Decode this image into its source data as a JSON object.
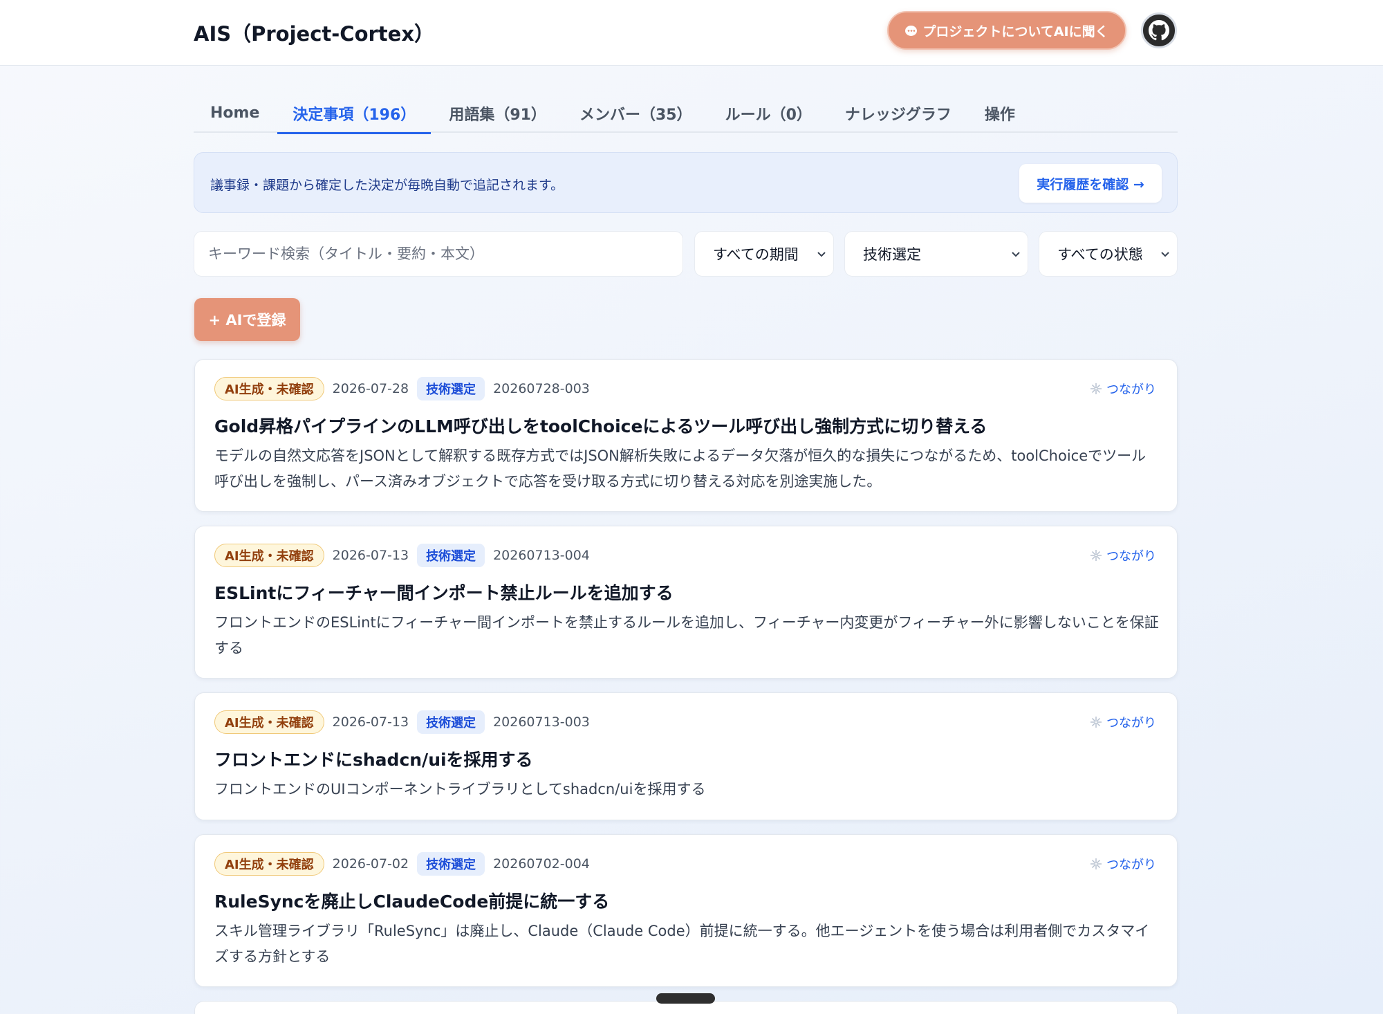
{
  "header": {
    "title": "AIS（Project-Cortex）",
    "ask_ai_label": "プロジェクトについてAIに聞く",
    "github_icon": "github-icon"
  },
  "tabs": [
    {
      "label": "Home",
      "active": false
    },
    {
      "label": "決定事項（196）",
      "active": true
    },
    {
      "label": "用語集（91）",
      "active": false
    },
    {
      "label": "メンバー（35）",
      "active": false
    },
    {
      "label": "ルール（0）",
      "active": false
    },
    {
      "label": "ナレッジグラフ",
      "active": false
    },
    {
      "label": "操作",
      "active": false
    }
  ],
  "banner": {
    "text": "議事録・課題から確定した決定が毎晩自動で追記されます。",
    "button_label": "実行履歴を確認 →"
  },
  "filters": {
    "search_placeholder": "キーワード検索（タイトル・要約・本文）",
    "search_value": "",
    "period": "すべての期間",
    "category": "技術選定",
    "status": "すべての状態"
  },
  "add_button_label": "+ AIで登録",
  "cards": [
    {
      "badge": "AI生成・未確認",
      "date": "2026-07-28",
      "category": "技術選定",
      "code": "20260728-003",
      "link_label": "つながり",
      "title": "Gold昇格パイプラインのLLM呼び出しをtoolChoiceによるツール呼び出し強制方式に切り替える",
      "summary": "モデルの自然文応答をJSONとして解釈する既存方式ではJSON解析失敗によるデータ欠落が恒久的な損失につながるため、toolChoiceでツール呼び出しを強制し、パース済みオブジェクトで応答を受け取る方式に切り替える対応を別途実施した。"
    },
    {
      "badge": "AI生成・未確認",
      "date": "2026-07-13",
      "category": "技術選定",
      "code": "20260713-004",
      "link_label": "つながり",
      "title": "ESLintにフィーチャー間インポート禁止ルールを追加する",
      "summary": "フロントエンドのESLintにフィーチャー間インポートを禁止するルールを追加し、フィーチャー内変更がフィーチャー外に影響しないことを保証する"
    },
    {
      "badge": "AI生成・未確認",
      "date": "2026-07-13",
      "category": "技術選定",
      "code": "20260713-003",
      "link_label": "つながり",
      "title": "フロントエンドにshadcn/uiを採用する",
      "summary": "フロントエンドのUIコンポーネントライブラリとしてshadcn/uiを採用する"
    },
    {
      "badge": "AI生成・未確認",
      "date": "2026-07-02",
      "category": "技術選定",
      "code": "20260702-004",
      "link_label": "つながり",
      "title": "RuleSyncを廃止しClaudeCode前提に統一する",
      "summary": "スキル管理ライブラリ「RuleSync」は廃止し、Claude（Claude Code）前提に統一する。他エージェントを使う場合は利用者側でカスタマイズする方針とする"
    }
  ]
}
